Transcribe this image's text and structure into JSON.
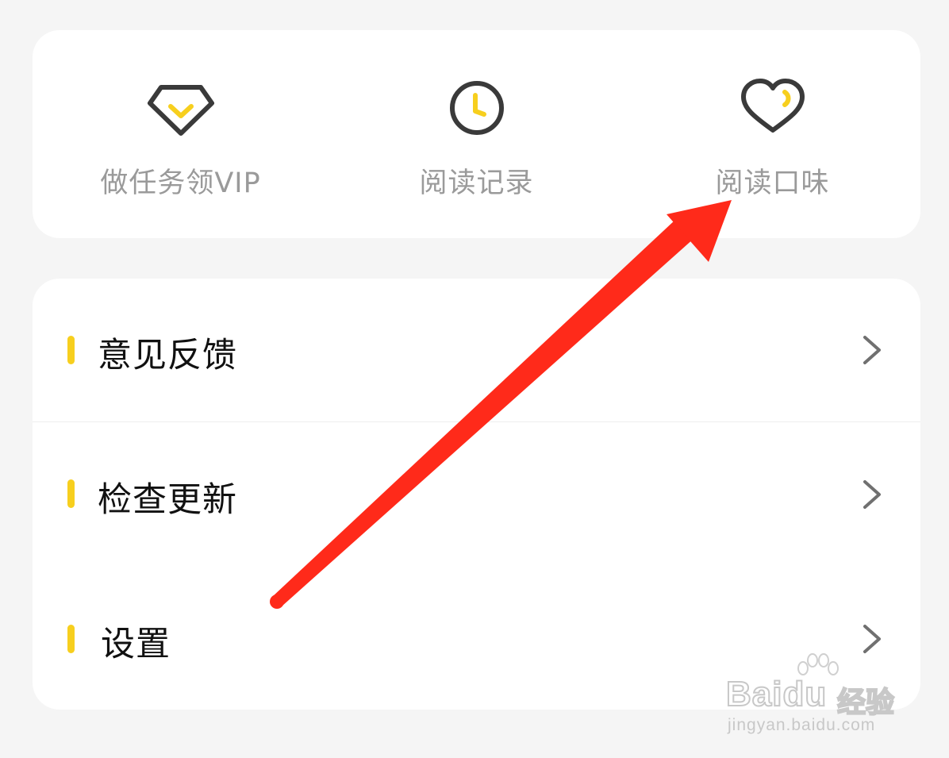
{
  "shortcuts": [
    {
      "label": "做任务领VIP",
      "icon": "diamond-icon"
    },
    {
      "label": "阅读记录",
      "icon": "clock-icon"
    },
    {
      "label": "阅读口味",
      "icon": "heart-icon"
    }
  ],
  "menu": [
    {
      "label": "意见反馈"
    },
    {
      "label": "检查更新"
    },
    {
      "label": "设置"
    }
  ],
  "watermark": {
    "brand": "Baidu",
    "sub": "经验",
    "url": "jingyan.baidu.com"
  },
  "colors": {
    "accent": "#f7cf1e",
    "icon_stroke": "#3a3a3a",
    "annotation_arrow": "#ff2a1a",
    "background": "#f5f5f5"
  }
}
